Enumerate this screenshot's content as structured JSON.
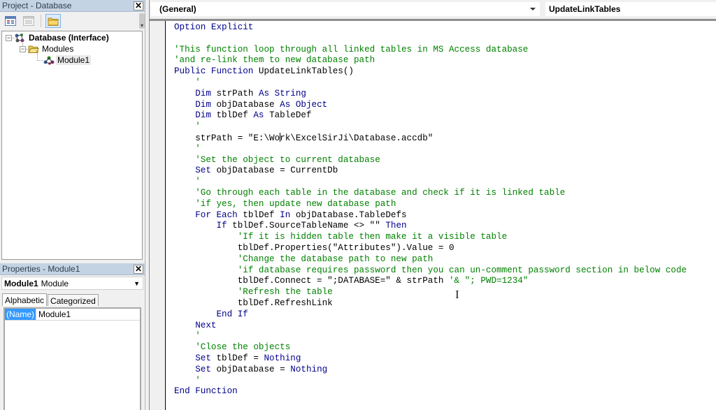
{
  "project_pane": {
    "title": "Project - Database",
    "close_label": "x",
    "toolbar": [
      {
        "name": "view-object-icon"
      },
      {
        "name": "view-code-icon"
      },
      {
        "name": "toggle-folders-icon",
        "active": true
      }
    ],
    "tree": {
      "root": "Database (Interface)",
      "folder": "Modules",
      "module": "Module1"
    }
  },
  "properties_pane": {
    "title": "Properties - Module1",
    "close_label": "x",
    "object_name": "Module1",
    "object_type": "Module",
    "tabs": [
      "Alphabetic",
      "Categorized"
    ],
    "active_tab": "Alphabetic",
    "rows": [
      {
        "name": "(Name)",
        "value": "Module1"
      }
    ]
  },
  "code_window": {
    "object_combo": "(General)",
    "procedure_combo": "UpdateLinkTables",
    "lines": [
      [
        [
          "kw",
          "Option Explicit"
        ]
      ],
      [],
      [
        [
          "cm",
          "'This function loop through all linked tables in MS Access database"
        ]
      ],
      [
        [
          "cm",
          "'and re-link them to new database path"
        ]
      ],
      [
        [
          "kw",
          "Public Function "
        ],
        [
          "t",
          "UpdateLinkTables()"
        ]
      ],
      [
        [
          "t",
          "    "
        ],
        [
          "cm",
          "'"
        ]
      ],
      [
        [
          "t",
          "    "
        ],
        [
          "kw",
          "Dim "
        ],
        [
          "t",
          "strPath "
        ],
        [
          "kw",
          "As String"
        ]
      ],
      [
        [
          "t",
          "    "
        ],
        [
          "kw",
          "Dim "
        ],
        [
          "t",
          "objDatabase "
        ],
        [
          "kw",
          "As Object"
        ]
      ],
      [
        [
          "t",
          "    "
        ],
        [
          "kw",
          "Dim "
        ],
        [
          "t",
          "tblDef "
        ],
        [
          "kw",
          "As "
        ],
        [
          "t",
          "TableDef"
        ]
      ],
      [
        [
          "t",
          "    "
        ],
        [
          "cm",
          "'"
        ]
      ],
      [
        [
          "t",
          "    strPath = \"E:\\Wo"
        ],
        [
          "cursor",
          ""
        ],
        [
          "t",
          "rk\\ExcelSirJi\\Database.accdb\""
        ]
      ],
      [
        [
          "t",
          "    "
        ],
        [
          "cm",
          "'"
        ]
      ],
      [
        [
          "t",
          "    "
        ],
        [
          "cm",
          "'Set the object to current database"
        ]
      ],
      [
        [
          "t",
          "    "
        ],
        [
          "kw",
          "Set "
        ],
        [
          "t",
          "objDatabase = CurrentDb"
        ]
      ],
      [
        [
          "t",
          "    "
        ],
        [
          "cm",
          "'"
        ]
      ],
      [
        [
          "t",
          "    "
        ],
        [
          "cm",
          "'Go through each table in the database and check if it is linked table"
        ]
      ],
      [
        [
          "t",
          "    "
        ],
        [
          "cm",
          "'if yes, then update new database path"
        ]
      ],
      [
        [
          "t",
          "    "
        ],
        [
          "kw",
          "For Each "
        ],
        [
          "t",
          "tblDef "
        ],
        [
          "kw",
          "In "
        ],
        [
          "t",
          "objDatabase.TableDefs"
        ]
      ],
      [
        [
          "t",
          "        "
        ],
        [
          "kw",
          "If "
        ],
        [
          "t",
          "tblDef.SourceTableName <> \"\" "
        ],
        [
          "kw",
          "Then"
        ]
      ],
      [
        [
          "t",
          "            "
        ],
        [
          "cm",
          "'If it is hidden table then make it a visible table"
        ]
      ],
      [
        [
          "t",
          "            tblDef.Properties(\"Attributes\").Value = 0"
        ]
      ],
      [
        [
          "t",
          "            "
        ],
        [
          "cm",
          "'Change the database path to new path"
        ]
      ],
      [
        [
          "t",
          "            "
        ],
        [
          "cm",
          "'if database requires password then you can un-comment password section in below code"
        ]
      ],
      [
        [
          "t",
          "            tblDef.Connect = \";DATABASE=\" & strPath "
        ],
        [
          "cm",
          "'& \"; PWD=1234\""
        ]
      ],
      [
        [
          "t",
          "            "
        ],
        [
          "cm",
          "'Refresh the table"
        ]
      ],
      [
        [
          "t",
          "            tblDef.RefreshLink"
        ]
      ],
      [
        [
          "t",
          "        "
        ],
        [
          "kw",
          "End If"
        ]
      ],
      [
        [
          "t",
          "    "
        ],
        [
          "kw",
          "Next"
        ]
      ],
      [
        [
          "t",
          "    "
        ],
        [
          "cm",
          "'"
        ]
      ],
      [
        [
          "t",
          "    "
        ],
        [
          "cm",
          "'Close the objects"
        ]
      ],
      [
        [
          "t",
          "    "
        ],
        [
          "kw",
          "Set "
        ],
        [
          "t",
          "tblDef = "
        ],
        [
          "kw",
          "Nothing"
        ]
      ],
      [
        [
          "t",
          "    "
        ],
        [
          "kw",
          "Set "
        ],
        [
          "t",
          "objDatabase = "
        ],
        [
          "kw",
          "Nothing"
        ]
      ],
      [
        [
          "t",
          "    "
        ],
        [
          "cm",
          "'"
        ]
      ],
      [
        [
          "kw",
          "End Function"
        ]
      ]
    ]
  },
  "colors": {
    "keyword": "#00008b",
    "comment": "#008000",
    "selection": "#3399ff",
    "title_bar": "#c4d3e3"
  }
}
